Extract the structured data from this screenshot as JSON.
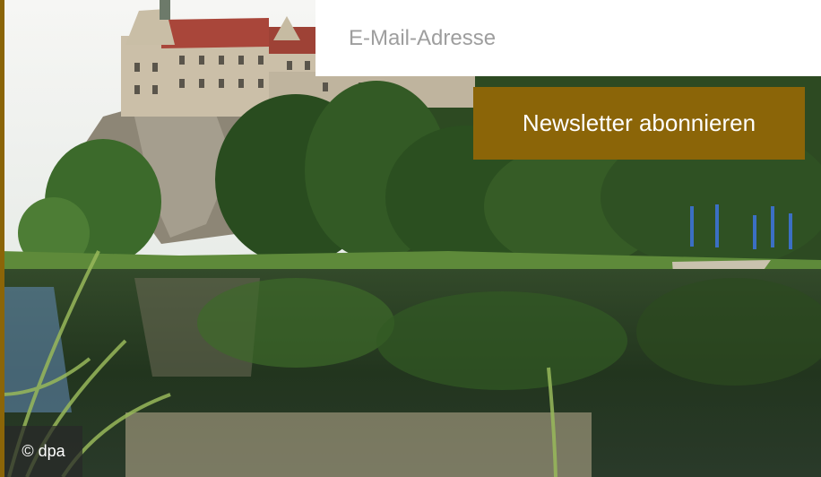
{
  "newsletter": {
    "email_placeholder": "E-Mail-Adresse",
    "email_value": "",
    "subscribe_label": "Newsletter abonnieren"
  },
  "hero": {
    "credit": "© dpa"
  },
  "colors": {
    "accent": "#8b6508",
    "button_text": "#ffffff",
    "input_background": "#ffffff"
  },
  "icons": [
    "castle-photo"
  ]
}
